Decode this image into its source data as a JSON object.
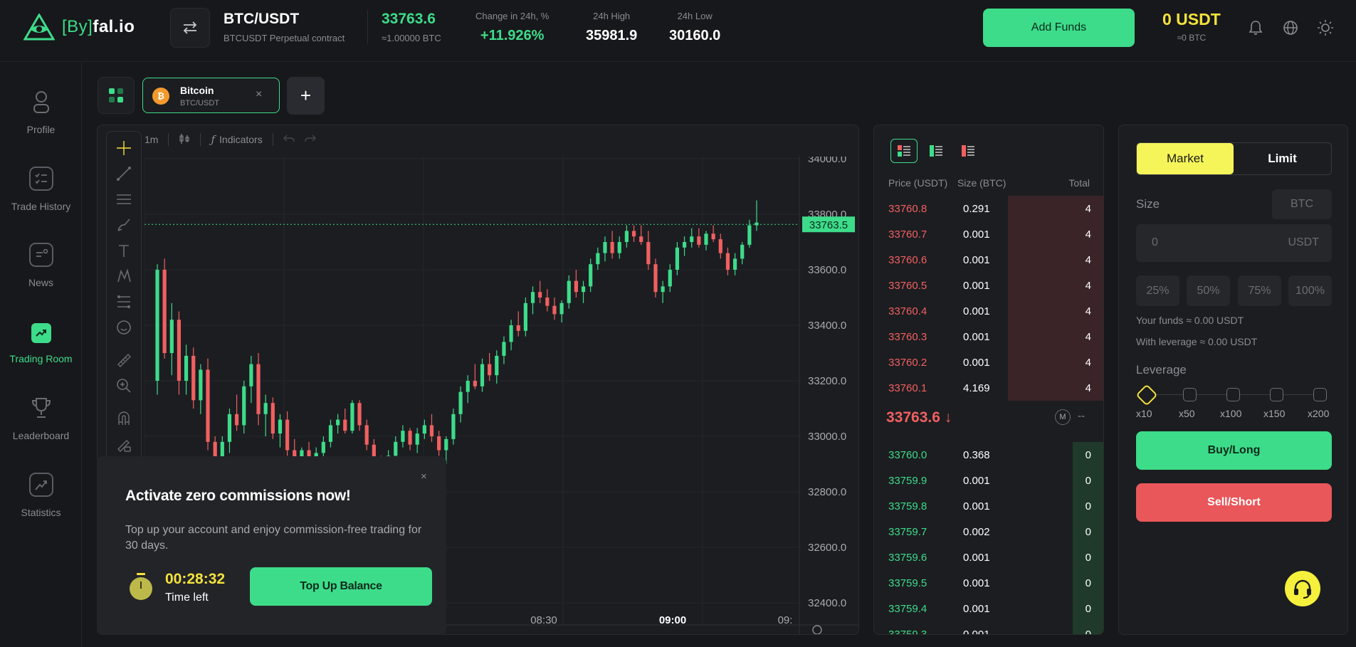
{
  "header": {
    "logo_text_left": "[By]",
    "logo_text_right": "fal.io",
    "pair_name": "BTC/USDT",
    "pair_sub": "BTCUSDT Perpetual contract",
    "last_price": "33763.6",
    "last_price_sub": "≈1.00000 BTC",
    "change_label": "Change in 24h, %",
    "change_value": "+11.926%",
    "high_label": "24h High",
    "high_value": "35981.9",
    "low_label": "24h Low",
    "low_value": "30160.0",
    "add_funds_label": "Add Funds",
    "balance": "0 USDT",
    "balance_sub": "≈0 BTC",
    "icons": [
      "swap-icon",
      "bell-icon",
      "globe-icon",
      "sun-icon"
    ]
  },
  "sidebar": {
    "items": [
      {
        "label": "Profile",
        "icon": "user-icon"
      },
      {
        "label": "Trade History",
        "icon": "checklist-icon"
      },
      {
        "label": "News",
        "icon": "news-icon"
      },
      {
        "label": "Trading Room",
        "icon": "trend-icon",
        "active": true
      },
      {
        "label": "Leaderboard",
        "icon": "trophy-icon"
      },
      {
        "label": "Statistics",
        "icon": "chart-icon"
      }
    ]
  },
  "tabs": {
    "active": {
      "name": "Bitcoin",
      "sub": "BTC/USDT",
      "coin_glyph": "₿",
      "close": "×"
    },
    "add": "+"
  },
  "chart": {
    "interval": "1m",
    "indicators_label": "Indicators",
    "current_price_tag": "33763.5",
    "price_ticks": [
      "34000.0",
      "33800.0",
      "33600.0",
      "33400.0",
      "33200.0",
      "33000.0",
      "32800.0",
      "32600.0",
      "32400.0"
    ],
    "time_ticks": [
      "08:30",
      "09:00",
      "09:"
    ]
  },
  "chart_data": {
    "type": "candlestick",
    "ylim": [
      32400,
      34000
    ],
    "current_price": 33763.5,
    "x_ticks": [
      "08:30",
      "09:00"
    ],
    "y_ticks": [
      34000,
      33800,
      33600,
      33400,
      33200,
      33000,
      32800,
      32600,
      32400
    ],
    "candles": [
      [
        33200,
        33620,
        33150,
        33600
      ],
      [
        33600,
        33640,
        33280,
        33300
      ],
      [
        33300,
        33480,
        33220,
        33420
      ],
      [
        33420,
        33450,
        33150,
        33200
      ],
      [
        33200,
        33330,
        33150,
        33290
      ],
      [
        33290,
        33320,
        33100,
        33130
      ],
      [
        33130,
        33260,
        33080,
        33240
      ],
      [
        33240,
        33280,
        32950,
        32980
      ],
      [
        32980,
        33000,
        32860,
        32900
      ],
      [
        32900,
        33000,
        32890,
        32980
      ],
      [
        32980,
        33100,
        32940,
        33080
      ],
      [
        33080,
        33150,
        33020,
        33040
      ],
      [
        33040,
        33200,
        33010,
        33180
      ],
      [
        33180,
        33290,
        33120,
        33260
      ],
      [
        33260,
        33300,
        33040,
        33080
      ],
      [
        33080,
        33150,
        33000,
        33120
      ],
      [
        33120,
        33140,
        32990,
        33010
      ],
      [
        33010,
        33080,
        32960,
        33060
      ],
      [
        33060,
        33090,
        32930,
        32950
      ],
      [
        32950,
        32990,
        32900,
        32920
      ],
      [
        32920,
        32960,
        32880,
        32950
      ],
      [
        32950,
        32980,
        32890,
        32900
      ],
      [
        32900,
        32960,
        32880,
        32940
      ],
      [
        32940,
        33000,
        32920,
        32980
      ],
      [
        32980,
        33060,
        32960,
        33040
      ],
      [
        33040,
        33080,
        33010,
        33060
      ],
      [
        33060,
        33100,
        33010,
        33020
      ],
      [
        33020,
        33130,
        33010,
        33120
      ],
      [
        33120,
        33130,
        33020,
        33040
      ],
      [
        33040,
        33060,
        32950,
        32970
      ],
      [
        32970,
        32990,
        32900,
        32920
      ],
      [
        32920,
        32930,
        32860,
        32880
      ],
      [
        32880,
        32950,
        32840,
        32930
      ],
      [
        32930,
        33000,
        32900,
        32980
      ],
      [
        32980,
        33040,
        32960,
        33020
      ],
      [
        33020,
        33030,
        32950,
        32970
      ],
      [
        32970,
        33030,
        32940,
        33010
      ],
      [
        33010,
        33060,
        32990,
        33040
      ],
      [
        33040,
        33080,
        32980,
        33000
      ],
      [
        33000,
        33020,
        32930,
        32950
      ],
      [
        32950,
        33000,
        32900,
        32990
      ],
      [
        32990,
        33100,
        32970,
        33080
      ],
      [
        33080,
        33180,
        33050,
        33160
      ],
      [
        33160,
        33220,
        33120,
        33200
      ],
      [
        33200,
        33260,
        33170,
        33180
      ],
      [
        33180,
        33280,
        33160,
        33260
      ],
      [
        33260,
        33300,
        33200,
        33220
      ],
      [
        33220,
        33310,
        33190,
        33290
      ],
      [
        33290,
        33360,
        33260,
        33340
      ],
      [
        33340,
        33420,
        33310,
        33400
      ],
      [
        33400,
        33450,
        33360,
        33380
      ],
      [
        33380,
        33500,
        33360,
        33480
      ],
      [
        33480,
        33540,
        33440,
        33520
      ],
      [
        33520,
        33560,
        33480,
        33500
      ],
      [
        33500,
        33530,
        33450,
        33470
      ],
      [
        33470,
        33500,
        33420,
        33440
      ],
      [
        33440,
        33490,
        33410,
        33480
      ],
      [
        33480,
        33580,
        33460,
        33560
      ],
      [
        33560,
        33600,
        33500,
        33520
      ],
      [
        33520,
        33560,
        33480,
        33540
      ],
      [
        33540,
        33640,
        33520,
        33620
      ],
      [
        33620,
        33680,
        33600,
        33660
      ],
      [
        33660,
        33720,
        33630,
        33700
      ],
      [
        33700,
        33740,
        33640,
        33660
      ],
      [
        33660,
        33720,
        33640,
        33700
      ],
      [
        33700,
        33760,
        33680,
        33740
      ],
      [
        33740,
        33760,
        33700,
        33720
      ],
      [
        33720,
        33760,
        33690,
        33700
      ],
      [
        33700,
        33740,
        33600,
        33620
      ],
      [
        33620,
        33640,
        33500,
        33520
      ],
      [
        33520,
        33560,
        33480,
        33540
      ],
      [
        33540,
        33620,
        33520,
        33600
      ],
      [
        33600,
        33700,
        33580,
        33680
      ],
      [
        33680,
        33720,
        33650,
        33700
      ],
      [
        33700,
        33750,
        33680,
        33720
      ],
      [
        33720,
        33750,
        33680,
        33690
      ],
      [
        33690,
        33740,
        33670,
        33730
      ],
      [
        33730,
        33760,
        33700,
        33710
      ],
      [
        33710,
        33730,
        33640,
        33660
      ],
      [
        33660,
        33680,
        33580,
        33600
      ],
      [
        33600,
        33660,
        33580,
        33640
      ],
      [
        33640,
        33700,
        33620,
        33690
      ],
      [
        33690,
        33780,
        33680,
        33760
      ],
      [
        33760,
        33850,
        33740,
        33770
      ]
    ]
  },
  "popup": {
    "close": "×",
    "title": "Activate zero commissions now!",
    "text": "Top up your account and enjoy commission-free trading for 30 days.",
    "timer": "00:28:32",
    "timer_label": "Time left",
    "button": "Top Up Balance"
  },
  "orderbook": {
    "headers": {
      "price": "Price (USDT)",
      "size": "Size (BTC)",
      "total": "Total"
    },
    "asks": [
      {
        "price": "33760.8",
        "size": "0.291",
        "total": "4",
        "depth": 0.42
      },
      {
        "price": "33760.7",
        "size": "0.001",
        "total": "4",
        "depth": 0.42
      },
      {
        "price": "33760.6",
        "size": "0.001",
        "total": "4",
        "depth": 0.42
      },
      {
        "price": "33760.5",
        "size": "0.001",
        "total": "4",
        "depth": 0.42
      },
      {
        "price": "33760.4",
        "size": "0.001",
        "total": "4",
        "depth": 0.42
      },
      {
        "price": "33760.3",
        "size": "0.001",
        "total": "4",
        "depth": 0.42
      },
      {
        "price": "33760.2",
        "size": "0.001",
        "total": "4",
        "depth": 0.42
      },
      {
        "price": "33760.1",
        "size": "4.169",
        "total": "4",
        "depth": 0.42
      }
    ],
    "mid_price": "33763.6 ↓",
    "mid_m": "M",
    "mid_dash": "--",
    "bids": [
      {
        "price": "33760.0",
        "size": "0.368",
        "total": "0",
        "depth": 0.14
      },
      {
        "price": "33759.9",
        "size": "0.001",
        "total": "0",
        "depth": 0.14
      },
      {
        "price": "33759.8",
        "size": "0.001",
        "total": "0",
        "depth": 0.14
      },
      {
        "price": "33759.7",
        "size": "0.002",
        "total": "0",
        "depth": 0.14
      },
      {
        "price": "33759.6",
        "size": "0.001",
        "total": "0",
        "depth": 0.14
      },
      {
        "price": "33759.5",
        "size": "0.001",
        "total": "0",
        "depth": 0.14
      },
      {
        "price": "33759.4",
        "size": "0.001",
        "total": "0",
        "depth": 0.14
      },
      {
        "price": "33759.3",
        "size": "0.001",
        "total": "0",
        "depth": 0.14
      }
    ]
  },
  "trade": {
    "market_label": "Market",
    "limit_label": "Limit",
    "size_label": "Size",
    "size_currency": "BTC",
    "amount_value": "0",
    "amount_unit": "USDT",
    "percents": [
      "25%",
      "50%",
      "75%",
      "100%"
    ],
    "your_funds": "Your funds ≈ 0.00 USDT",
    "with_leverage": "With leverage ≈ 0.00 USDT",
    "leverage_label": "Leverage",
    "leverage_options": [
      "x10",
      "x50",
      "x100",
      "x150",
      "x200"
    ],
    "buy_label": "Buy/Long",
    "sell_label": "Sell/Short"
  },
  "colors": {
    "accent": "#3ddc8a",
    "sell": "#e9575a",
    "highlight": "#f5e23c",
    "background": "#17181b"
  }
}
